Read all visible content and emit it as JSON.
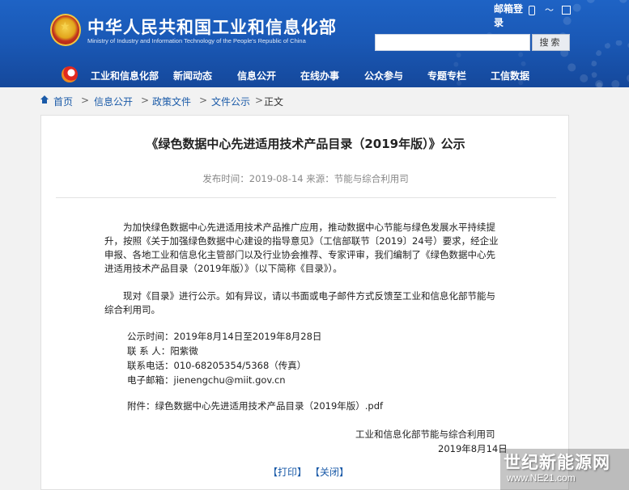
{
  "header": {
    "site_title": "中华人民共和国工业和信息化部",
    "site_subtitle": "Ministry of Industry and Information Technology of the People's Republic of China",
    "mail_label": "邮箱登录",
    "search_button": "搜索",
    "search_value": "",
    "icons": [
      "phone-icon",
      "rss-icon",
      "grid-icon"
    ]
  },
  "nav": {
    "items": [
      "工业和信息化部",
      "新闻动态",
      "信息公开",
      "在线办事",
      "公众参与",
      "专题专栏",
      "工信数据"
    ]
  },
  "breadcrumb": {
    "items": [
      "首页",
      "信息公开",
      "政策文件",
      "文件公示",
      "正文"
    ],
    "separator": ">"
  },
  "article": {
    "title": "《绿色数据中心先进适用技术产品目录（2019年版）》公示",
    "meta": "发布时间：2019-08-14  来源：节能与综合利用司",
    "paragraph1": "为加快绿色数据中心先进适用技术产品推广应用，推动数据中心节能与绿色发展水平持续提升，按照《关于加强绿色数据中心建设的指导意见》（工信部联节〔2019〕24号）要求，经企业申报、各地工业和信息化主管部门以及行业协会推荐、专家评审，我们编制了《绿色数据中心先进适用技术产品目录（2019年版）》（以下简称《目录》）。",
    "paragraph2": "现对《目录》进行公示。如有异议，请以书面或电子邮件方式反馈至工业和信息化部节能与综合利用司。",
    "contact": {
      "period": "公示时间：2019年8月14日至2019年8月28日",
      "person": "联 系 人：阳紫微",
      "phone": "联系电话：010-68205354/5368（传真）",
      "email": "电子邮箱：jienengchu@miit.gov.cn"
    },
    "attachment": "附件：绿色数据中心先进适用技术产品目录（2019年版）.pdf",
    "signature_org": "工业和信息化部节能与综合利用司",
    "signature_date": "2019年8月14日",
    "print_label": "【打印】",
    "close_label": "【关闭】"
  },
  "watermark": {
    "main": "世纪新能源网",
    "url": "www.NE21.com"
  },
  "colors": {
    "header_blue": "#1a58b5",
    "link_blue": "#1a5aa8",
    "panel_bg": "#ffffff",
    "page_bg": "#f2f2f2"
  }
}
